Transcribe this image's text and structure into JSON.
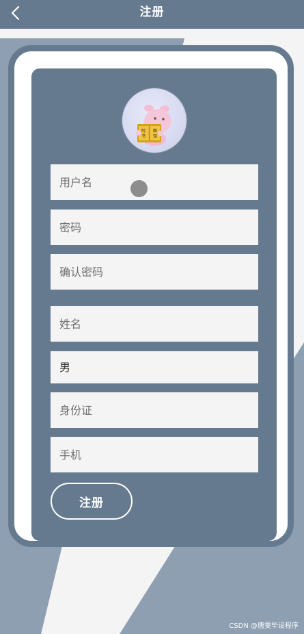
{
  "header": {
    "title": "注册",
    "back_icon": "chevron-left-icon"
  },
  "avatar": {
    "book_text": "阿 图\n书 馆"
  },
  "form": {
    "username_placeholder": "用户名",
    "password_placeholder": "密码",
    "confirm_password_placeholder": "确认密码",
    "name_placeholder": "姓名",
    "gender_value": "男",
    "id_card_placeholder": "身份证",
    "phone_placeholder": "手机",
    "submit_label": "注册"
  },
  "watermark": "CSDN @唐雯毕设程序",
  "colors": {
    "primary": "#667a8f",
    "background": "#f4f4f5",
    "field": "#f4f4f4",
    "white": "#ffffff"
  }
}
